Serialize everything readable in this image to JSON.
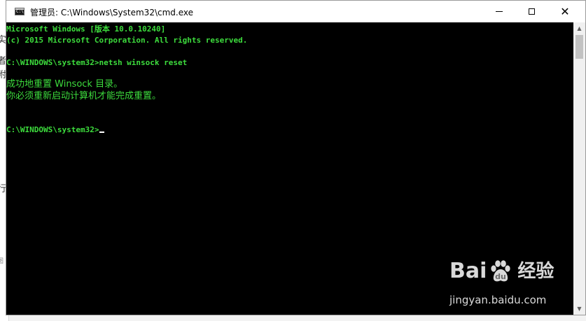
{
  "background_page": {
    "fragments": [
      "实",
      "者",
      "附",
      "行",
      "图"
    ]
  },
  "window": {
    "title": "管理员: C:\\Windows\\System32\\cmd.exe",
    "app_icon": "cmd-icon",
    "controls": {
      "minimize_icon": "minimize-icon",
      "maximize_icon": "maximize-icon",
      "close_icon": "close-icon",
      "close_glyph": "✕"
    }
  },
  "console": {
    "text_color": "#3ddc3d",
    "background": "#000000",
    "lines": [
      "Microsoft Windows [版本 10.0.10240]",
      "(c) 2015 Microsoft Corporation. All rights reserved.",
      "C:\\WINDOWS\\system32>netsh winsock reset",
      "成功地重置 Winsock 目录。",
      "你必须重新启动计算机才能完成重置。",
      "C:\\WINDOWS\\system32>"
    ]
  },
  "scrollbar": {
    "up_glyph": "▲",
    "down_glyph": "▼"
  },
  "watermark": {
    "brand_left": "Bai",
    "brand_right": "经验",
    "url": "jingyan.baidu.com",
    "paw_icon": "baidu-paw-icon"
  }
}
